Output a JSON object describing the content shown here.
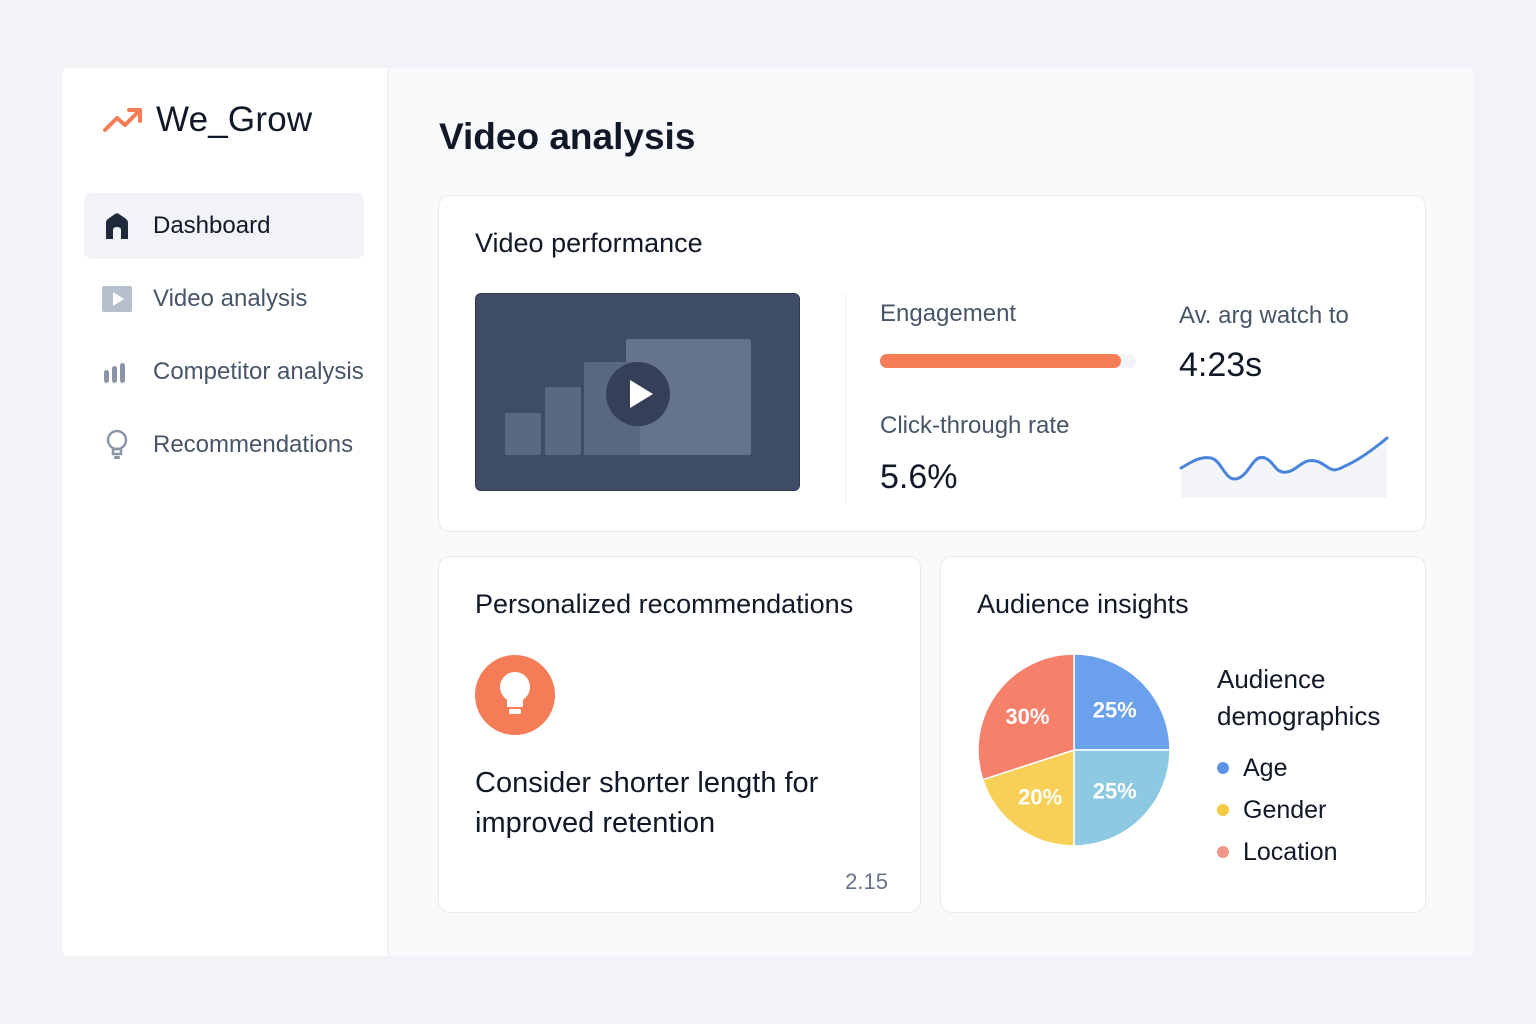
{
  "brand": {
    "name": "We_Grow",
    "icon": "trending-up-icon",
    "icon_color": "#f47c57"
  },
  "sidebar": {
    "items": [
      {
        "label": "Dashboard",
        "icon": "home-icon",
        "active": true
      },
      {
        "label": "Video analysis",
        "icon": "video-icon",
        "active": false
      },
      {
        "label": "Competitor analysis",
        "icon": "bar-chart-icon",
        "active": false
      },
      {
        "label": "Recommendations",
        "icon": "lightbulb-icon",
        "active": false
      }
    ]
  },
  "page": {
    "title": "Video analysis"
  },
  "performance": {
    "title": "Video performance",
    "engagement_label": "Engagement",
    "engagement_fraction": 0.94,
    "ctr_label": "Click-through rate",
    "ctr_value": "5.6%",
    "watch_label": "Av. arg watch to",
    "watch_value": "4:23s",
    "accent": "#f47c57",
    "sparkline_color": "#4a84dc"
  },
  "recommendations": {
    "title": "Personalized recommendations",
    "text": "Consider shorter length for improved retention",
    "value": "2.15",
    "icon": "lightbulb-icon"
  },
  "audience": {
    "title": "Audience insights",
    "demographics_title": "Audience demographics",
    "legend": [
      {
        "label": "Age",
        "color": "#5b93e6"
      },
      {
        "label": "Gender",
        "color": "#f6c942"
      },
      {
        "label": "Location",
        "color": "#f0968a"
      }
    ]
  },
  "chart_data": {
    "type": "pie",
    "slices": [
      {
        "label": "25%",
        "value": 25,
        "color": "#6aa0ec"
      },
      {
        "label": "25%",
        "value": 25,
        "color": "#8ec9e2"
      },
      {
        "label": "20%",
        "value": 20,
        "color": "#f8d058"
      },
      {
        "label": "30%",
        "value": 30,
        "color": "#f6806a"
      }
    ]
  }
}
